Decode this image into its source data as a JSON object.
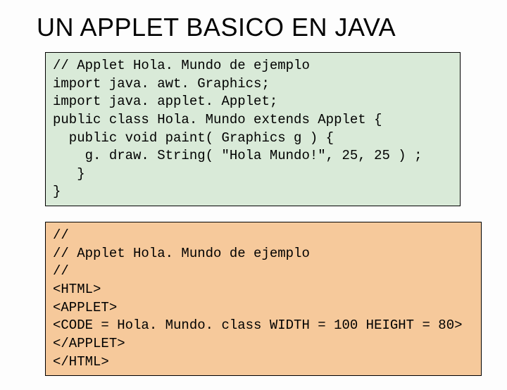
{
  "title": "UN APPLET BASICO EN JAVA",
  "codeGreen": "// Applet Hola. Mundo de ejemplo\nimport java. awt. Graphics;\nimport java. applet. Applet;\npublic class Hola. Mundo extends Applet {\n  public void paint( Graphics g ) {\n    g. draw. String( \"Hola Mundo!\", 25, 25 ) ;\n   }\n}",
  "codeOrange": "//\n// Applet Hola. Mundo de ejemplo\n//\n<HTML>\n<APPLET>\n<CODE = Hola. Mundo. class WIDTH = 100 HEIGHT = 80>\n</APPLET>\n</HTML>"
}
